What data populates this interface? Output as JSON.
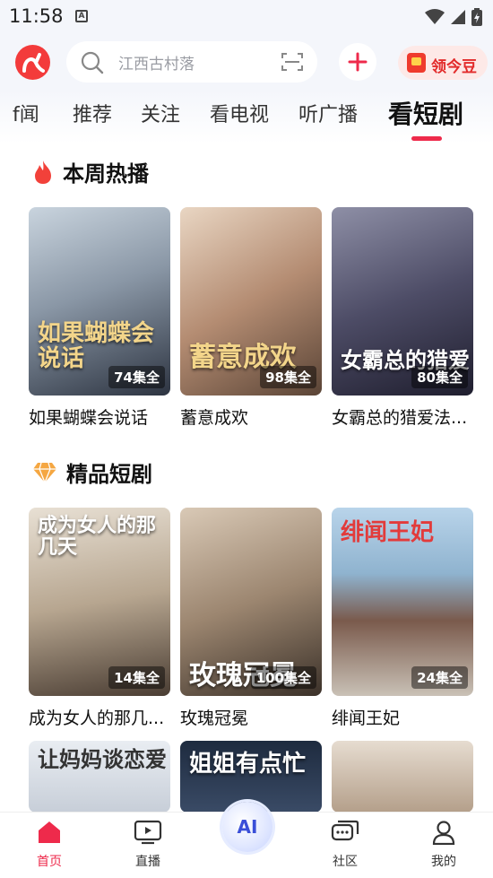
{
  "status_bar": {
    "time": "11:58",
    "notification_glyph": "A"
  },
  "search": {
    "placeholder": "江西古村落"
  },
  "bean_button": {
    "label": "领今豆"
  },
  "tabs": [
    {
      "label": "f闻"
    },
    {
      "label": "推荐"
    },
    {
      "label": "关注"
    },
    {
      "label": "看电视"
    },
    {
      "label": "听广播"
    },
    {
      "label": "看短剧",
      "active": true
    }
  ],
  "sections": [
    {
      "title": "本周热播",
      "icon": "fire-icon",
      "cards": [
        {
          "title": "如果蝴蝶会说话",
          "poster_text": "如果蝴蝶会说话",
          "episodes": "74集全"
        },
        {
          "title": "蓄意成欢",
          "poster_text": "蓄意成欢",
          "episodes": "98集全"
        },
        {
          "title": "女霸总的猎爱法...",
          "poster_text": "女霸总的猎爱",
          "episodes": "80集全"
        }
      ]
    },
    {
      "title": "精品短剧",
      "icon": "diamond-icon",
      "cards": [
        {
          "title": "成为女人的那几...",
          "poster_text": "成为女人的那几天",
          "episodes": "14集全"
        },
        {
          "title": "玫瑰冠冕",
          "poster_text": "玫瑰冠冕",
          "episodes": "100集全"
        },
        {
          "title": "绯闻王妃",
          "poster_text": "绯闻王妃",
          "episodes": "24集全"
        }
      ]
    }
  ],
  "partial_row": [
    {
      "poster_text": "让妈妈谈恋爱"
    },
    {
      "poster_text": "姐姐有点忙"
    },
    {
      "poster_text": ""
    }
  ],
  "bottom_nav": [
    {
      "label": "首页",
      "icon": "home-icon",
      "active": true
    },
    {
      "label": "直播",
      "icon": "tv-play-icon"
    },
    {
      "label": "AI",
      "icon": "ai-assistant-icon"
    },
    {
      "label": "社区",
      "icon": "chat-bubbles-icon"
    },
    {
      "label": "我的",
      "icon": "person-icon"
    }
  ],
  "colors": {
    "accent": "#ee2a4b",
    "logo": "#f33b3b",
    "bean": "#e22b2b"
  }
}
